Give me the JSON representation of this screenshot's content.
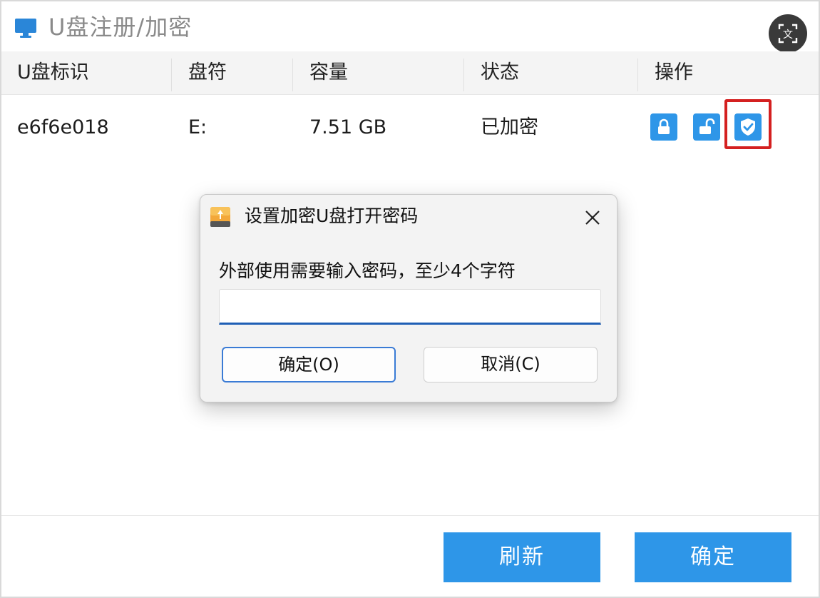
{
  "window": {
    "title": "U盘注册/加密"
  },
  "table": {
    "columns": [
      "U盘标识",
      "盘符",
      "容量",
      "状态",
      "操作"
    ],
    "rows": [
      {
        "id": "e6f6e018",
        "drive": "E:",
        "capacity": "7.51 GB",
        "status": "已加密"
      }
    ],
    "actions": [
      {
        "icon": "lock-icon"
      },
      {
        "icon": "unlock-icon"
      },
      {
        "icon": "shield-check-icon",
        "highlighted": true
      }
    ]
  },
  "footer": {
    "refresh_label": "刷新",
    "ok_label": "确定"
  },
  "dialog": {
    "title": "设置加密U盘打开密码",
    "prompt": "外部使用需要输入密码，至少4个字符",
    "password_value": "",
    "ok_label": "确定(O)",
    "cancel_label": "取消(C)"
  },
  "colors": {
    "accent": "#2e96e8",
    "highlight": "#d42020",
    "input_focus": "#1f5fb5"
  }
}
